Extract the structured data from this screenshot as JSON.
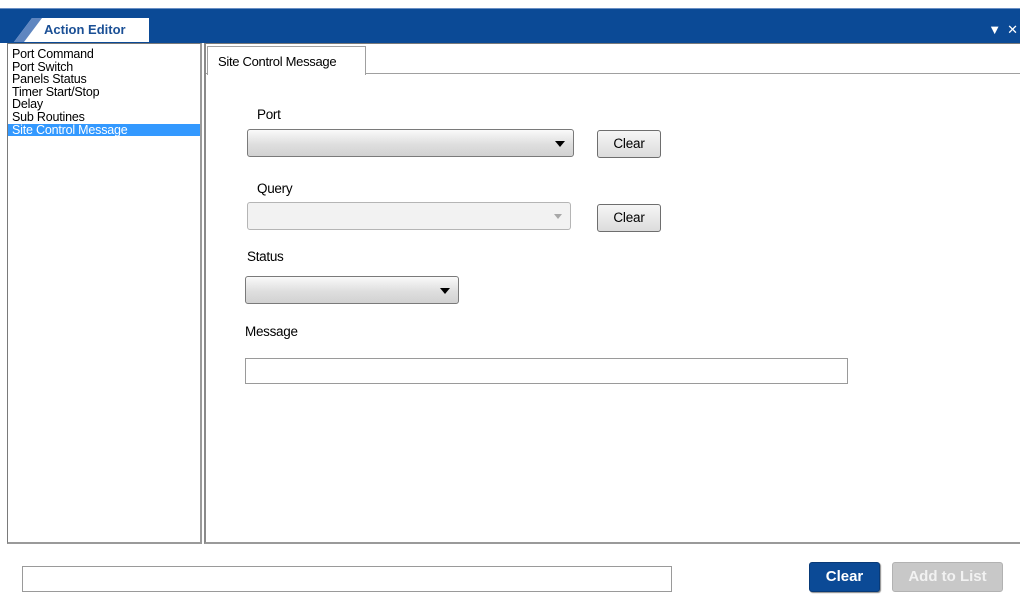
{
  "window": {
    "title": "Action Editor",
    "controls": {
      "pin_icon": "dropdown-arrow-icon",
      "close_icon": "close-icon"
    }
  },
  "sidebar": {
    "items": [
      {
        "label": "Port Command",
        "selected": false
      },
      {
        "label": "Port Switch",
        "selected": false
      },
      {
        "label": "Panels Status",
        "selected": false
      },
      {
        "label": "Timer Start/Stop",
        "selected": false
      },
      {
        "label": "Delay",
        "selected": false
      },
      {
        "label": "Sub Routines",
        "selected": false
      },
      {
        "label": "Site Control Message",
        "selected": true
      }
    ]
  },
  "main": {
    "tab_label": "Site Control Message",
    "port": {
      "label": "Port",
      "value": "",
      "clear_label": "Clear"
    },
    "query": {
      "label": "Query",
      "value": "",
      "clear_label": "Clear",
      "disabled": true
    },
    "status": {
      "label": "Status",
      "value": ""
    },
    "message": {
      "label": "Message",
      "value": ""
    }
  },
  "footer": {
    "input_value": "",
    "clear_label": "Clear",
    "add_label": "Add to List"
  },
  "colors": {
    "titlebar": "#0b4a96",
    "selection": "#3399ff",
    "primary_button": "#0b4a96",
    "disabled_button": "#c8c8c8"
  }
}
